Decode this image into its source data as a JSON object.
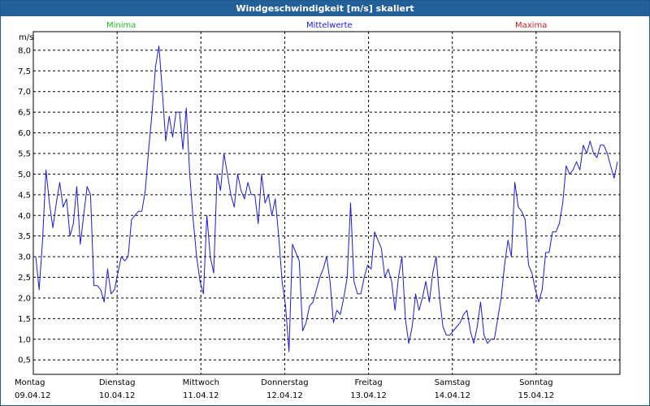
{
  "window": {
    "title": "Windgeschwindigkeit [m/s] skaliert"
  },
  "legend": {
    "min": "Minima",
    "mean": "Mittelwerte",
    "max": "Maxima"
  },
  "colors": {
    "title_bar": "#23609a",
    "series": "#1a1ad8",
    "min": "#22b822",
    "max": "#c82020",
    "grid": "#000000"
  },
  "chart_data": {
    "type": "line",
    "title": "Windgeschwindigkeit [m/s] skaliert",
    "ylabel": "m/s",
    "ylim": [
      0.15,
      8.45
    ],
    "yticks": [
      "0,5",
      "1,0",
      "1,5",
      "2,0",
      "2,5",
      "3,0",
      "3,5",
      "4,0",
      "4,5",
      "5,0",
      "5,5",
      "6,0",
      "6,5",
      "7,0",
      "7,5",
      "8,0"
    ],
    "grid": true,
    "days": [
      {
        "weekday": "Montag",
        "date": "09.04.12"
      },
      {
        "weekday": "Dienstag",
        "date": "10.04.12"
      },
      {
        "weekday": "Mittwoch",
        "date": "11.04.12"
      },
      {
        "weekday": "Donnerstag",
        "date": "12.04.12"
      },
      {
        "weekday": "Freitag",
        "date": "13.04.12"
      },
      {
        "weekday": "Samstag",
        "date": "14.04.12"
      },
      {
        "weekday": "Sonntag",
        "date": "15.04.12"
      }
    ],
    "series": [
      {
        "values": [
          3.0,
          2.2,
          3.4,
          5.1,
          4.3,
          3.7,
          4.3,
          4.8,
          4.2,
          4.4,
          3.5,
          3.8,
          4.7,
          3.3,
          4.0,
          4.7,
          4.5,
          2.3,
          2.3,
          2.2,
          1.9,
          2.7,
          2.1,
          2.2,
          2.6,
          3.0,
          2.9,
          3.0,
          3.9,
          4.0,
          4.1,
          4.1,
          4.6,
          5.6,
          6.5,
          7.6,
          8.1,
          7.0,
          5.8,
          6.4,
          5.9,
          6.5,
          6.5,
          5.6,
          6.6,
          5.0,
          3.9,
          3.0,
          2.4,
          2.1,
          4.0,
          3.0,
          2.6,
          5.0,
          4.6,
          5.5,
          5.0,
          4.5,
          4.2,
          5.0,
          4.6,
          4.4,
          4.8,
          4.5,
          4.5,
          3.8,
          5.0,
          4.3,
          4.5,
          4.0,
          4.4,
          3.5,
          2.4,
          1.8,
          0.7,
          3.3,
          3.1,
          2.9,
          1.2,
          1.4,
          1.8,
          1.9,
          2.2,
          2.5,
          2.7,
          3.0,
          2.4,
          1.4,
          1.7,
          1.6,
          2.0,
          2.5,
          4.3,
          2.4,
          2.1,
          2.1,
          2.5,
          2.8,
          2.7,
          3.6,
          3.4,
          3.2,
          2.5,
          2.7,
          2.4,
          1.7,
          2.5,
          3.0,
          1.5,
          0.9,
          1.3,
          2.1,
          1.7,
          2.0,
          2.4,
          1.9,
          2.6,
          3.0,
          2.0,
          1.3,
          1.1,
          1.1,
          1.2,
          1.3,
          1.4,
          1.6,
          1.7,
          1.2,
          0.9,
          1.3,
          1.9,
          1.1,
          0.9,
          1.0,
          1.0,
          1.5,
          2.0,
          2.8,
          3.4,
          3.0,
          4.8,
          4.2,
          4.1,
          3.9,
          2.8,
          2.6,
          2.2,
          1.9,
          2.2,
          3.1,
          3.1,
          3.6,
          3.6,
          3.8,
          4.3,
          5.2,
          5.0,
          5.1,
          5.3,
          5.1,
          5.7,
          5.5,
          5.8,
          5.5,
          5.4,
          5.7,
          5.7,
          5.5,
          5.2,
          4.9,
          5.3
        ]
      }
    ]
  }
}
